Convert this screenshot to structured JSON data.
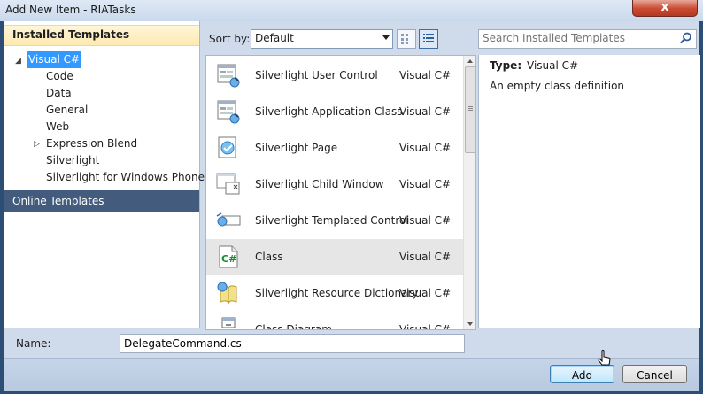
{
  "window": {
    "title": "Add New Item - RIATasks",
    "close_glyph": "x"
  },
  "left_pane": {
    "installed_header": "Installed Templates",
    "tree": [
      {
        "label": "Visual C#",
        "selected": true,
        "expanded": true
      },
      {
        "label": "Code"
      },
      {
        "label": "Data"
      },
      {
        "label": "General"
      },
      {
        "label": "Web"
      },
      {
        "label": "Expression Blend",
        "has_children": true
      },
      {
        "label": "Silverlight"
      },
      {
        "label": "Silverlight for Windows Phone"
      }
    ],
    "online_header": "Online Templates"
  },
  "toolbar": {
    "sort_label": "Sort by:",
    "sort_value": "Default",
    "search_placeholder": "Search Installed Templates"
  },
  "templates": [
    {
      "name": "Silverlight User Control",
      "language": "Visual C#",
      "icon": "user-control-icon"
    },
    {
      "name": "Silverlight Application Class",
      "language": "Visual C#",
      "icon": "application-class-icon"
    },
    {
      "name": "Silverlight Page",
      "language": "Visual C#",
      "icon": "page-icon"
    },
    {
      "name": "Silverlight Child Window",
      "language": "Visual C#",
      "icon": "child-window-icon"
    },
    {
      "name": "Silverlight Templated Control",
      "language": "Visual C#",
      "icon": "templated-control-icon"
    },
    {
      "name": "Class",
      "language": "Visual C#",
      "icon": "csharp-class-icon",
      "selected": true
    },
    {
      "name": "Silverlight Resource Dictionary",
      "language": "Visual C#",
      "icon": "resource-dictionary-icon"
    },
    {
      "name": "Class Diagram",
      "language": "Visual C#",
      "icon": "class-diagram-icon"
    }
  ],
  "details": {
    "type_label": "Type:",
    "type_value": "Visual C#",
    "description": "An empty class definition"
  },
  "name_field": {
    "label": "Name:",
    "value": "DelegateCommand.cs"
  },
  "buttons": {
    "add": "Add",
    "cancel": "Cancel"
  },
  "colors": {
    "selection": "#3399ff",
    "online_header": "#435b7c",
    "installed_header": "#fde9b0"
  }
}
